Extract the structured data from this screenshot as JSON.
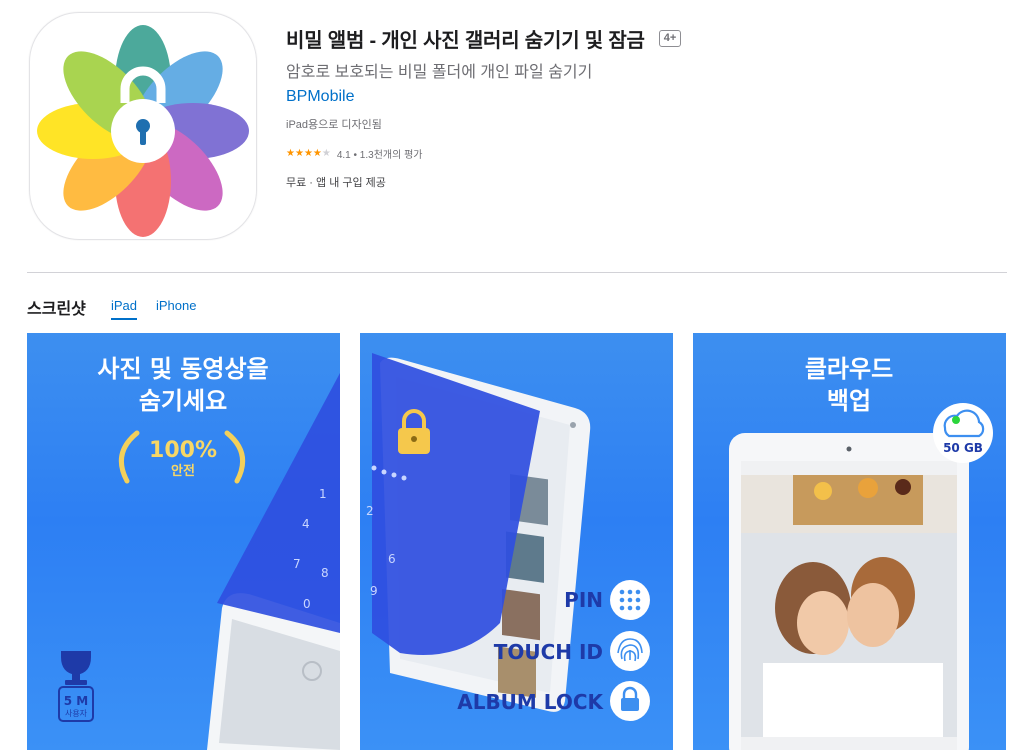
{
  "app": {
    "title": "비밀 앨범 - 개인 사진 갤러리 숨기기 및 잠금",
    "age_rating": "4+",
    "subtitle": "암호로 보호되는 비밀 폴더에 개인 파일 숨기기",
    "developer": "BPMobile",
    "designed_for": "iPad용으로 디자인됨",
    "rating": 4.1,
    "rating_text": "4.1 • 1.3천개의 평가",
    "price": "무료 · 앱 내 구입 제공"
  },
  "screenshots": {
    "section_title": "스크린샷",
    "tabs": [
      "iPad",
      "iPhone"
    ],
    "shot1": {
      "headline_1": "사진 및 동영상을",
      "headline_2": "숨기세요",
      "badge_value": "100%",
      "badge_label": "안전",
      "keypad": [
        "1",
        "4",
        "7",
        "8",
        "0"
      ],
      "users_value": "5 M",
      "users_label": "사용자"
    },
    "shot2": {
      "keypad": [
        "2",
        "6",
        "9"
      ],
      "features": [
        "PIN",
        "TOUCH ID",
        "ALBUM LOCK"
      ]
    },
    "shot3": {
      "headline_1": "클라우드",
      "headline_2": "백업",
      "storage": "50 GB"
    }
  },
  "colors": {
    "link_blue": "#0070c9",
    "star_orange": "#ff9500",
    "screenshot_blue": "#2d7ff3"
  }
}
